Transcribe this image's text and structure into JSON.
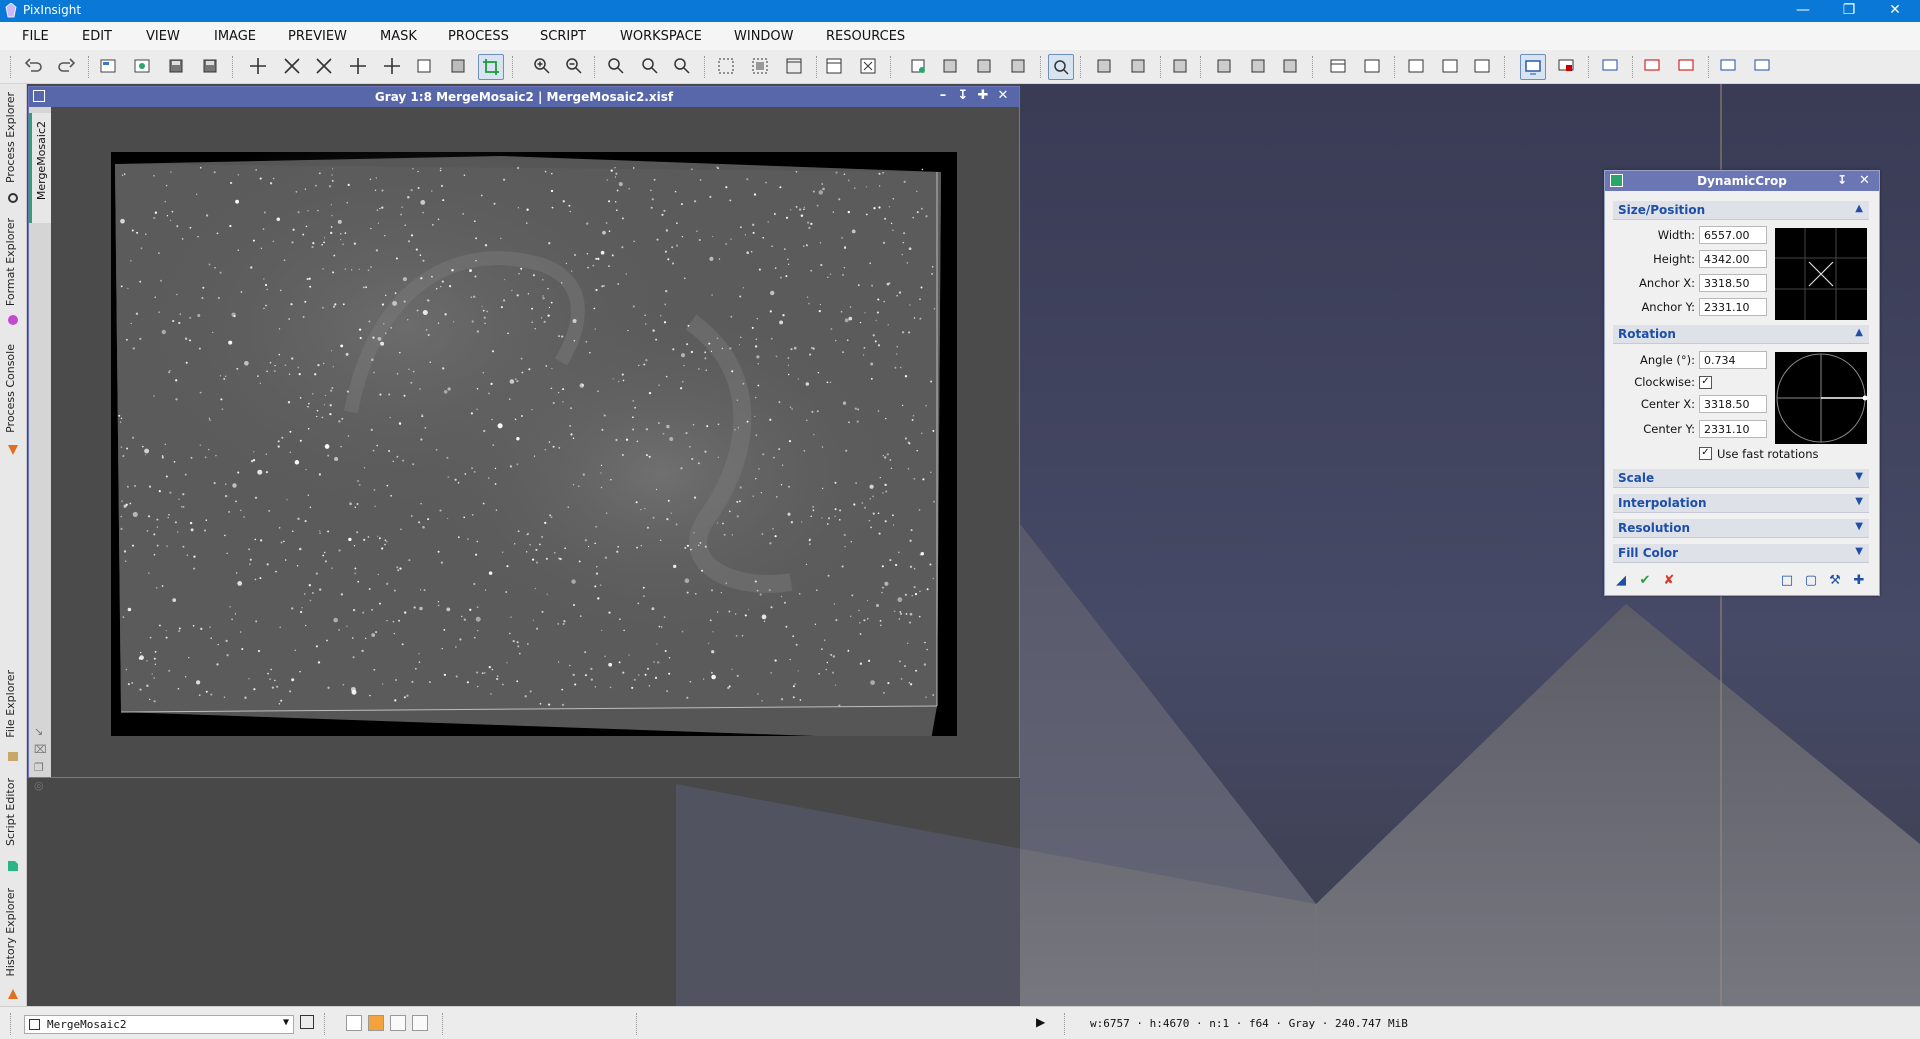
{
  "window": {
    "title": "PixInsight",
    "controls": [
      "minimize-icon",
      "restore-icon",
      "close-icon"
    ]
  },
  "menubar": [
    "FILE",
    "EDIT",
    "VIEW",
    "IMAGE",
    "PREVIEW",
    "MASK",
    "PROCESS",
    "SCRIPT",
    "WORKSPACE",
    "WINDOW",
    "RESOURCES"
  ],
  "left_dock": {
    "tabs": [
      "Process Explorer",
      "Format Explorer",
      "Process Console",
      "File Explorer",
      "Script Editor",
      "History Explorer"
    ]
  },
  "image_window": {
    "title": "Gray 1:8 MergeMosaic2 | MergeMosaic2.xisf",
    "view_tab": "MergeMosaic2",
    "controls": [
      "minimize-icon",
      "shade-icon",
      "maximize-icon",
      "close-icon"
    ]
  },
  "dynamic_crop": {
    "title": "DynamicCrop",
    "sections": {
      "size_position": {
        "label": "Size/Position",
        "width_label": "Width:",
        "width": "6557.00",
        "height_label": "Height:",
        "height": "4342.00",
        "anchor_x_label": "Anchor X:",
        "anchor_x": "3318.50",
        "anchor_y_label": "Anchor Y:",
        "anchor_y": "2331.10"
      },
      "rotation": {
        "label": "Rotation",
        "angle_label": "Angle (°):",
        "angle": "0.734",
        "clockwise_label": "Clockwise:",
        "clockwise": true,
        "center_x_label": "Center X:",
        "center_x": "3318.50",
        "center_y_label": "Center Y:",
        "center_y": "2331.10",
        "fast_rotations_label": "Use fast rotations",
        "fast_rotations": true
      },
      "scale": {
        "label": "Scale"
      },
      "interpolation": {
        "label": "Interpolation"
      },
      "resolution": {
        "label": "Resolution"
      },
      "fill_color": {
        "label": "Fill Color"
      }
    }
  },
  "statusbar": {
    "view_selected": "MergeMosaic2",
    "info": "w:6757 · h:4670 · n:1 · f64 · Gray · 240.747 MiB"
  },
  "colors": {
    "titlebar": "#0a78d7",
    "image_window_title": "#5767a9",
    "dialog_title": "#6b76b4",
    "section_text": "#1d4fa8"
  }
}
